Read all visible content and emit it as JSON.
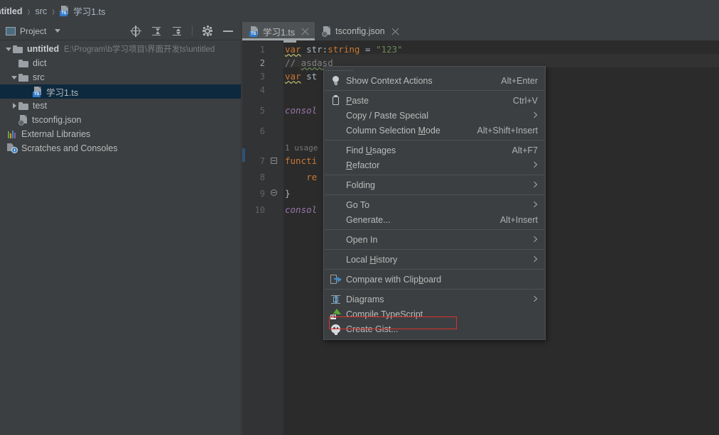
{
  "breadcrumb": {
    "items": [
      {
        "label": "ntitled",
        "bold": true,
        "icon": "none"
      },
      {
        "label": "src",
        "bold": false,
        "icon": "none"
      },
      {
        "label": "学习1.ts",
        "bold": false,
        "icon": "typescript-file-icon"
      }
    ],
    "separator": "›"
  },
  "project_panel": {
    "title": "Project",
    "actions": [
      {
        "name": "select-opened-file-button",
        "icon": "target-icon"
      },
      {
        "name": "expand-all-button",
        "icon": "expand-all-icon"
      },
      {
        "name": "collapse-all-button",
        "icon": "collapse-all-icon"
      },
      {
        "name": "settings-button",
        "icon": "gear-icon"
      },
      {
        "name": "hide-button",
        "icon": "minimize-icon"
      }
    ],
    "tree": [
      {
        "label": "untitled",
        "path": "E:\\Program\\b学习项目\\界面开发ts\\untitled",
        "indent": 0,
        "arrow": "down",
        "icon": "folder-icon",
        "bold": true,
        "selected": false
      },
      {
        "label": "dict",
        "path": "",
        "indent": 1,
        "arrow": "none",
        "icon": "folder-icon",
        "bold": false,
        "selected": false
      },
      {
        "label": "src",
        "path": "",
        "indent": 1,
        "arrow": "down",
        "icon": "folder-icon",
        "bold": false,
        "selected": false
      },
      {
        "label": "学习1.ts",
        "path": "",
        "indent": 2,
        "arrow": "none",
        "icon": "typescript-file-icon",
        "bold": false,
        "selected": true
      },
      {
        "label": "test",
        "path": "",
        "indent": 1,
        "arrow": "right",
        "icon": "folder-icon",
        "bold": false,
        "selected": false
      },
      {
        "label": "tsconfig.json",
        "path": "",
        "indent": 1,
        "arrow": "none",
        "icon": "json-file-icon",
        "bold": false,
        "selected": false
      },
      {
        "label": "External Libraries",
        "path": "",
        "indent": 0,
        "arrow": "none",
        "icon": "libraries-icon",
        "bold": false,
        "selected": false
      },
      {
        "label": "Scratches and Consoles",
        "path": "",
        "indent": 0,
        "arrow": "none",
        "icon": "scratches-icon",
        "bold": false,
        "selected": false
      }
    ]
  },
  "editor": {
    "tabs": [
      {
        "label": "学习1.ts",
        "icon": "typescript-file-icon",
        "active": true
      },
      {
        "label": "tsconfig.json",
        "icon": "json-file-icon",
        "active": false
      }
    ],
    "line_numbers": [
      "1",
      "2",
      "3",
      "4",
      "5",
      "6",
      "7",
      "8",
      "9",
      "10"
    ],
    "current_line": "2",
    "usage_hint": "1 usage",
    "code_lines": [
      "var str:string = \"123\"",
      "// asdasd",
      "var st",
      "",
      "consol",
      "",
      "functi",
      "    re",
      "}",
      "consol"
    ]
  },
  "context_menu": {
    "items": [
      {
        "label": "Show Context Actions",
        "mnemonic": "",
        "shortcut": "Alt+Enter",
        "submenu": false,
        "icon": "lightbulb-icon",
        "separator_after": true,
        "highlighted": false
      },
      {
        "label": "Paste",
        "mnemonic": "P",
        "shortcut": "Ctrl+V",
        "submenu": false,
        "icon": "clipboard-icon",
        "separator_after": false,
        "highlighted": false
      },
      {
        "label": "Copy / Paste Special",
        "mnemonic": "",
        "shortcut": "",
        "submenu": true,
        "icon": "none",
        "separator_after": false,
        "highlighted": false
      },
      {
        "label": "Column Selection Mode",
        "mnemonic": "M",
        "shortcut": "Alt+Shift+Insert",
        "submenu": false,
        "icon": "none",
        "separator_after": true,
        "highlighted": false
      },
      {
        "label": "Find Usages",
        "mnemonic": "U",
        "shortcut": "Alt+F7",
        "submenu": false,
        "icon": "none",
        "separator_after": false,
        "highlighted": false
      },
      {
        "label": "Refactor",
        "mnemonic": "R",
        "shortcut": "",
        "submenu": true,
        "icon": "none",
        "separator_after": true,
        "highlighted": false
      },
      {
        "label": "Folding",
        "mnemonic": "",
        "shortcut": "",
        "submenu": true,
        "icon": "none",
        "separator_after": true,
        "highlighted": false
      },
      {
        "label": "Go To",
        "mnemonic": "",
        "shortcut": "",
        "submenu": true,
        "icon": "none",
        "separator_after": false,
        "highlighted": false
      },
      {
        "label": "Generate...",
        "mnemonic": "",
        "shortcut": "Alt+Insert",
        "submenu": false,
        "icon": "none",
        "separator_after": true,
        "highlighted": false
      },
      {
        "label": "Open In",
        "mnemonic": "",
        "shortcut": "",
        "submenu": true,
        "icon": "none",
        "separator_after": true,
        "highlighted": false
      },
      {
        "label": "Local History",
        "mnemonic": "H",
        "shortcut": "",
        "submenu": true,
        "icon": "none",
        "separator_after": true,
        "highlighted": false
      },
      {
        "label": "Compare with Clipboard",
        "mnemonic": "b",
        "shortcut": "",
        "submenu": false,
        "icon": "compare-icon",
        "separator_after": true,
        "highlighted": false
      },
      {
        "label": "Diagrams",
        "mnemonic": "",
        "shortcut": "",
        "submenu": true,
        "icon": "diagram-icon",
        "separator_after": false,
        "highlighted": false
      },
      {
        "label": "Compile TypeScript",
        "mnemonic": "",
        "shortcut": "",
        "submenu": false,
        "icon": "typescript-compile-icon",
        "separator_after": false,
        "highlighted": true
      },
      {
        "label": "Create Gist...",
        "mnemonic": "",
        "shortcut": "",
        "submenu": false,
        "icon": "github-icon",
        "separator_after": false,
        "highlighted": false
      }
    ]
  },
  "colors": {
    "panel_bg": "#3c3f41",
    "editor_bg": "#2b2b2b",
    "gutter_bg": "#313335",
    "tree_selection": "#0d293e",
    "menu_bg": "#3c3f41",
    "annotation_red": "#e03030",
    "keyword": "#cc7832",
    "string": "#6a8759",
    "comment": "#808080",
    "function": "#ffc66d",
    "static_field": "#9876aa",
    "text": "#a9b7c6"
  }
}
